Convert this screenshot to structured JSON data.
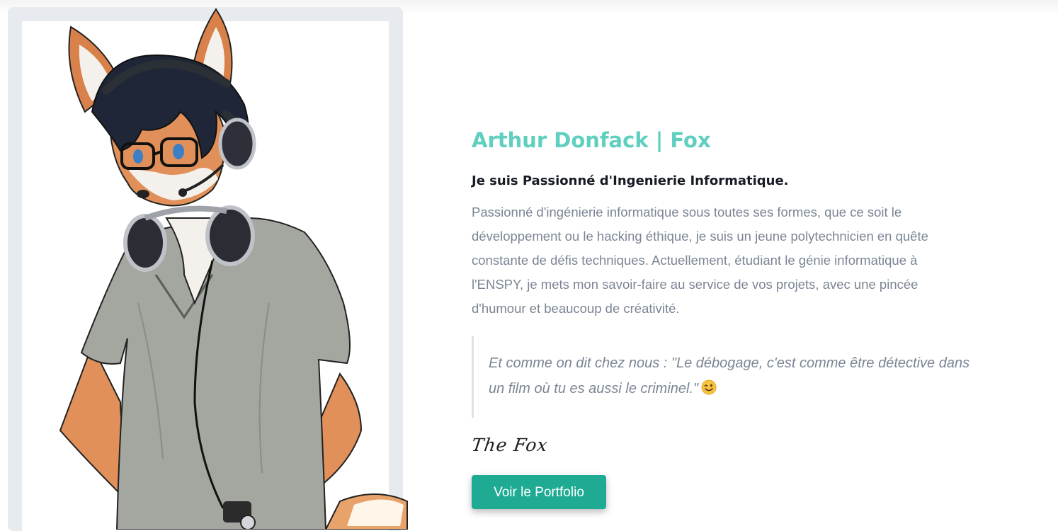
{
  "profile": {
    "name": "Arthur Donfack | Fox",
    "tagline": "Je suis Passionné d'Ingenierie Informatique.",
    "bio": "Passionné d'ingénierie informatique sous toutes ses formes, que ce soit le développement ou le hacking éthique, je suis un jeune polytechnicien en quête constante de défis techniques. Actuellement, étudiant le génie informatique à l'ENSPY, je mets mon savoir-faire au service de vos projets, avec une pincée d'humour et beaucoup de créativité.",
    "quote": "Et comme on dit chez nous : \"Le débogage, c'est comme être détective dans un film où tu es aussi le criminel.\"",
    "signature": "The Fox",
    "cta_label": "Voir le Portfolio"
  },
  "icons": {
    "quote_emoji": "winking-face-icon"
  },
  "colors": {
    "accent": "#5fcfbf",
    "button": "#1fab93",
    "heading": "#161b24",
    "body_text": "#7a8594",
    "frame": "#e7ebef"
  }
}
